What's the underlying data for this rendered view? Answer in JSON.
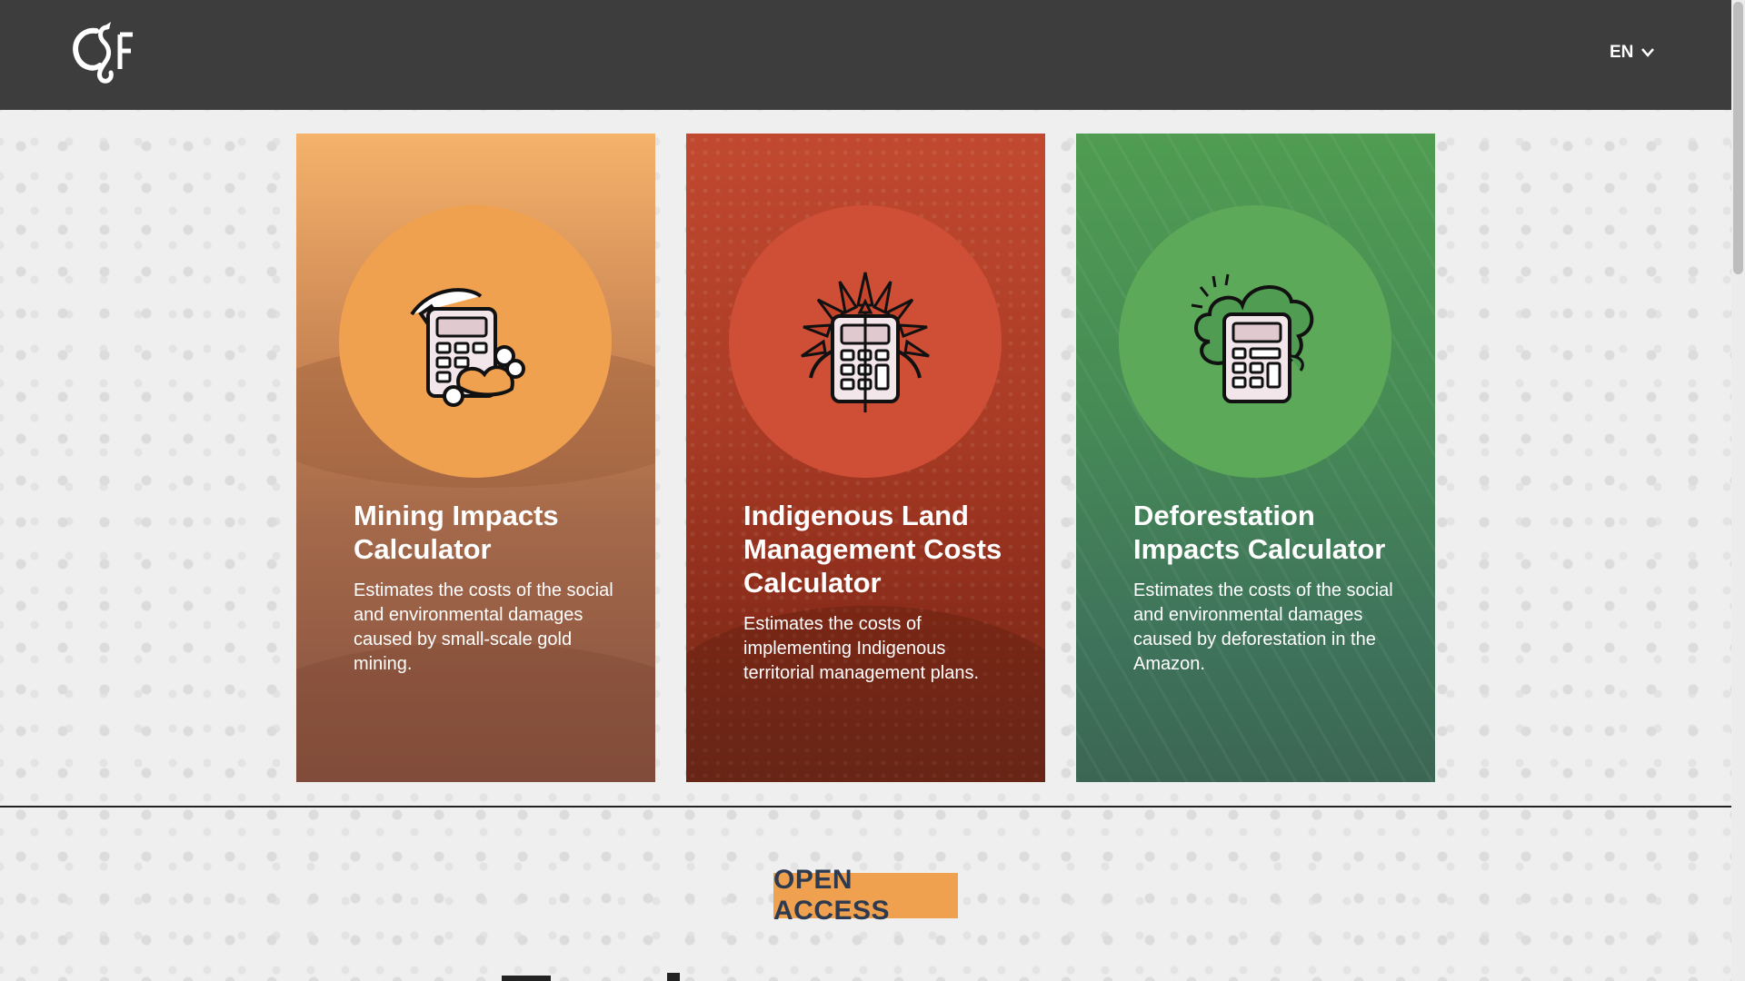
{
  "header": {
    "logo_name": "csf-logo",
    "language": "EN"
  },
  "cards": [
    {
      "title": "Mining Impacts Calculator",
      "description": "Estimates the costs of the social and environmental damages caused by small-scale gold mining.",
      "accent": "#f0a14f",
      "icon": "pickaxe-calculator-icon"
    },
    {
      "title": "Indigenous Land Management Costs Calculator",
      "description": "Estimates the costs of implementing Indigenous territorial management plans.",
      "accent": "#cf4f36",
      "icon": "headdress-calculator-icon"
    },
    {
      "title": "Deforestation Impacts Calculator",
      "description": "Estimates the costs of the social and environmental damages caused by deforestation in the Amazon.",
      "accent": "#5da95a",
      "icon": "tree-calculator-icon"
    }
  ],
  "section": {
    "badge": "OPEN ACCESS",
    "badge_color": "#f0a14f"
  }
}
